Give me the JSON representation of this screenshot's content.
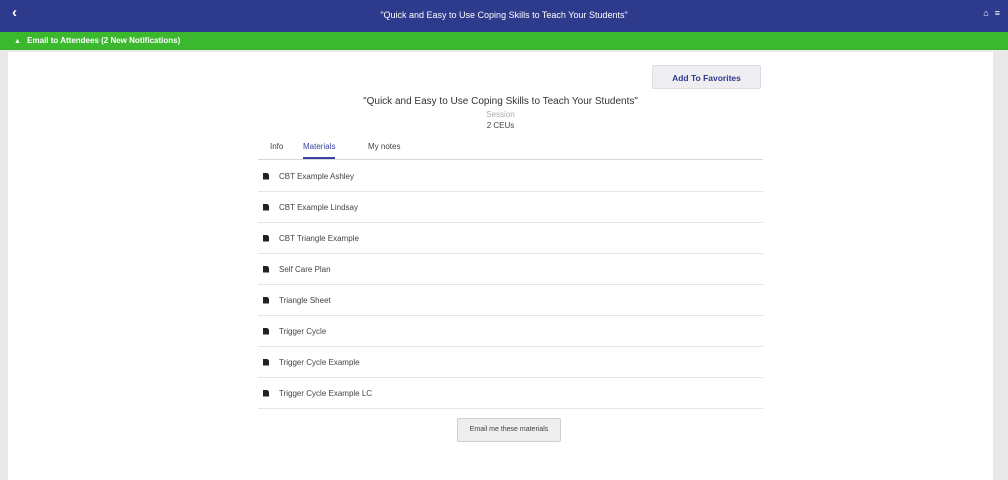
{
  "header": {
    "back_icon": "‹",
    "title": "\"Quick and Easy to Use Coping Skills to Teach Your Students\"",
    "home_icon": "⌂",
    "menu_icon": "≡"
  },
  "notification": {
    "icon": "▲",
    "text": "Email to Attendees (2 New Notifications)"
  },
  "session": {
    "favorites_label": "Add To Favorites",
    "title": "\"Quick and Easy to Use Coping Skills to Teach Your Students\"",
    "type": "Session",
    "ceus": "2 CEUs"
  },
  "tabs": [
    {
      "label": "Info"
    },
    {
      "label": "Materials"
    },
    {
      "label": "My notes"
    }
  ],
  "materials": [
    {
      "label": "CBT Example Ashley"
    },
    {
      "label": "CBT Example Lindsay"
    },
    {
      "label": "CBT Triangle Example"
    },
    {
      "label": "Self Care Plan"
    },
    {
      "label": "Triangle Sheet"
    },
    {
      "label": "Trigger Cycle"
    },
    {
      "label": "Trigger Cycle Example"
    },
    {
      "label": "Trigger Cycle Example LC"
    }
  ],
  "email_button_label": "Email me these materials",
  "colors": {
    "header": "#2e3a8c",
    "notification": "#3cb82e",
    "accent": "#3a44a0"
  }
}
